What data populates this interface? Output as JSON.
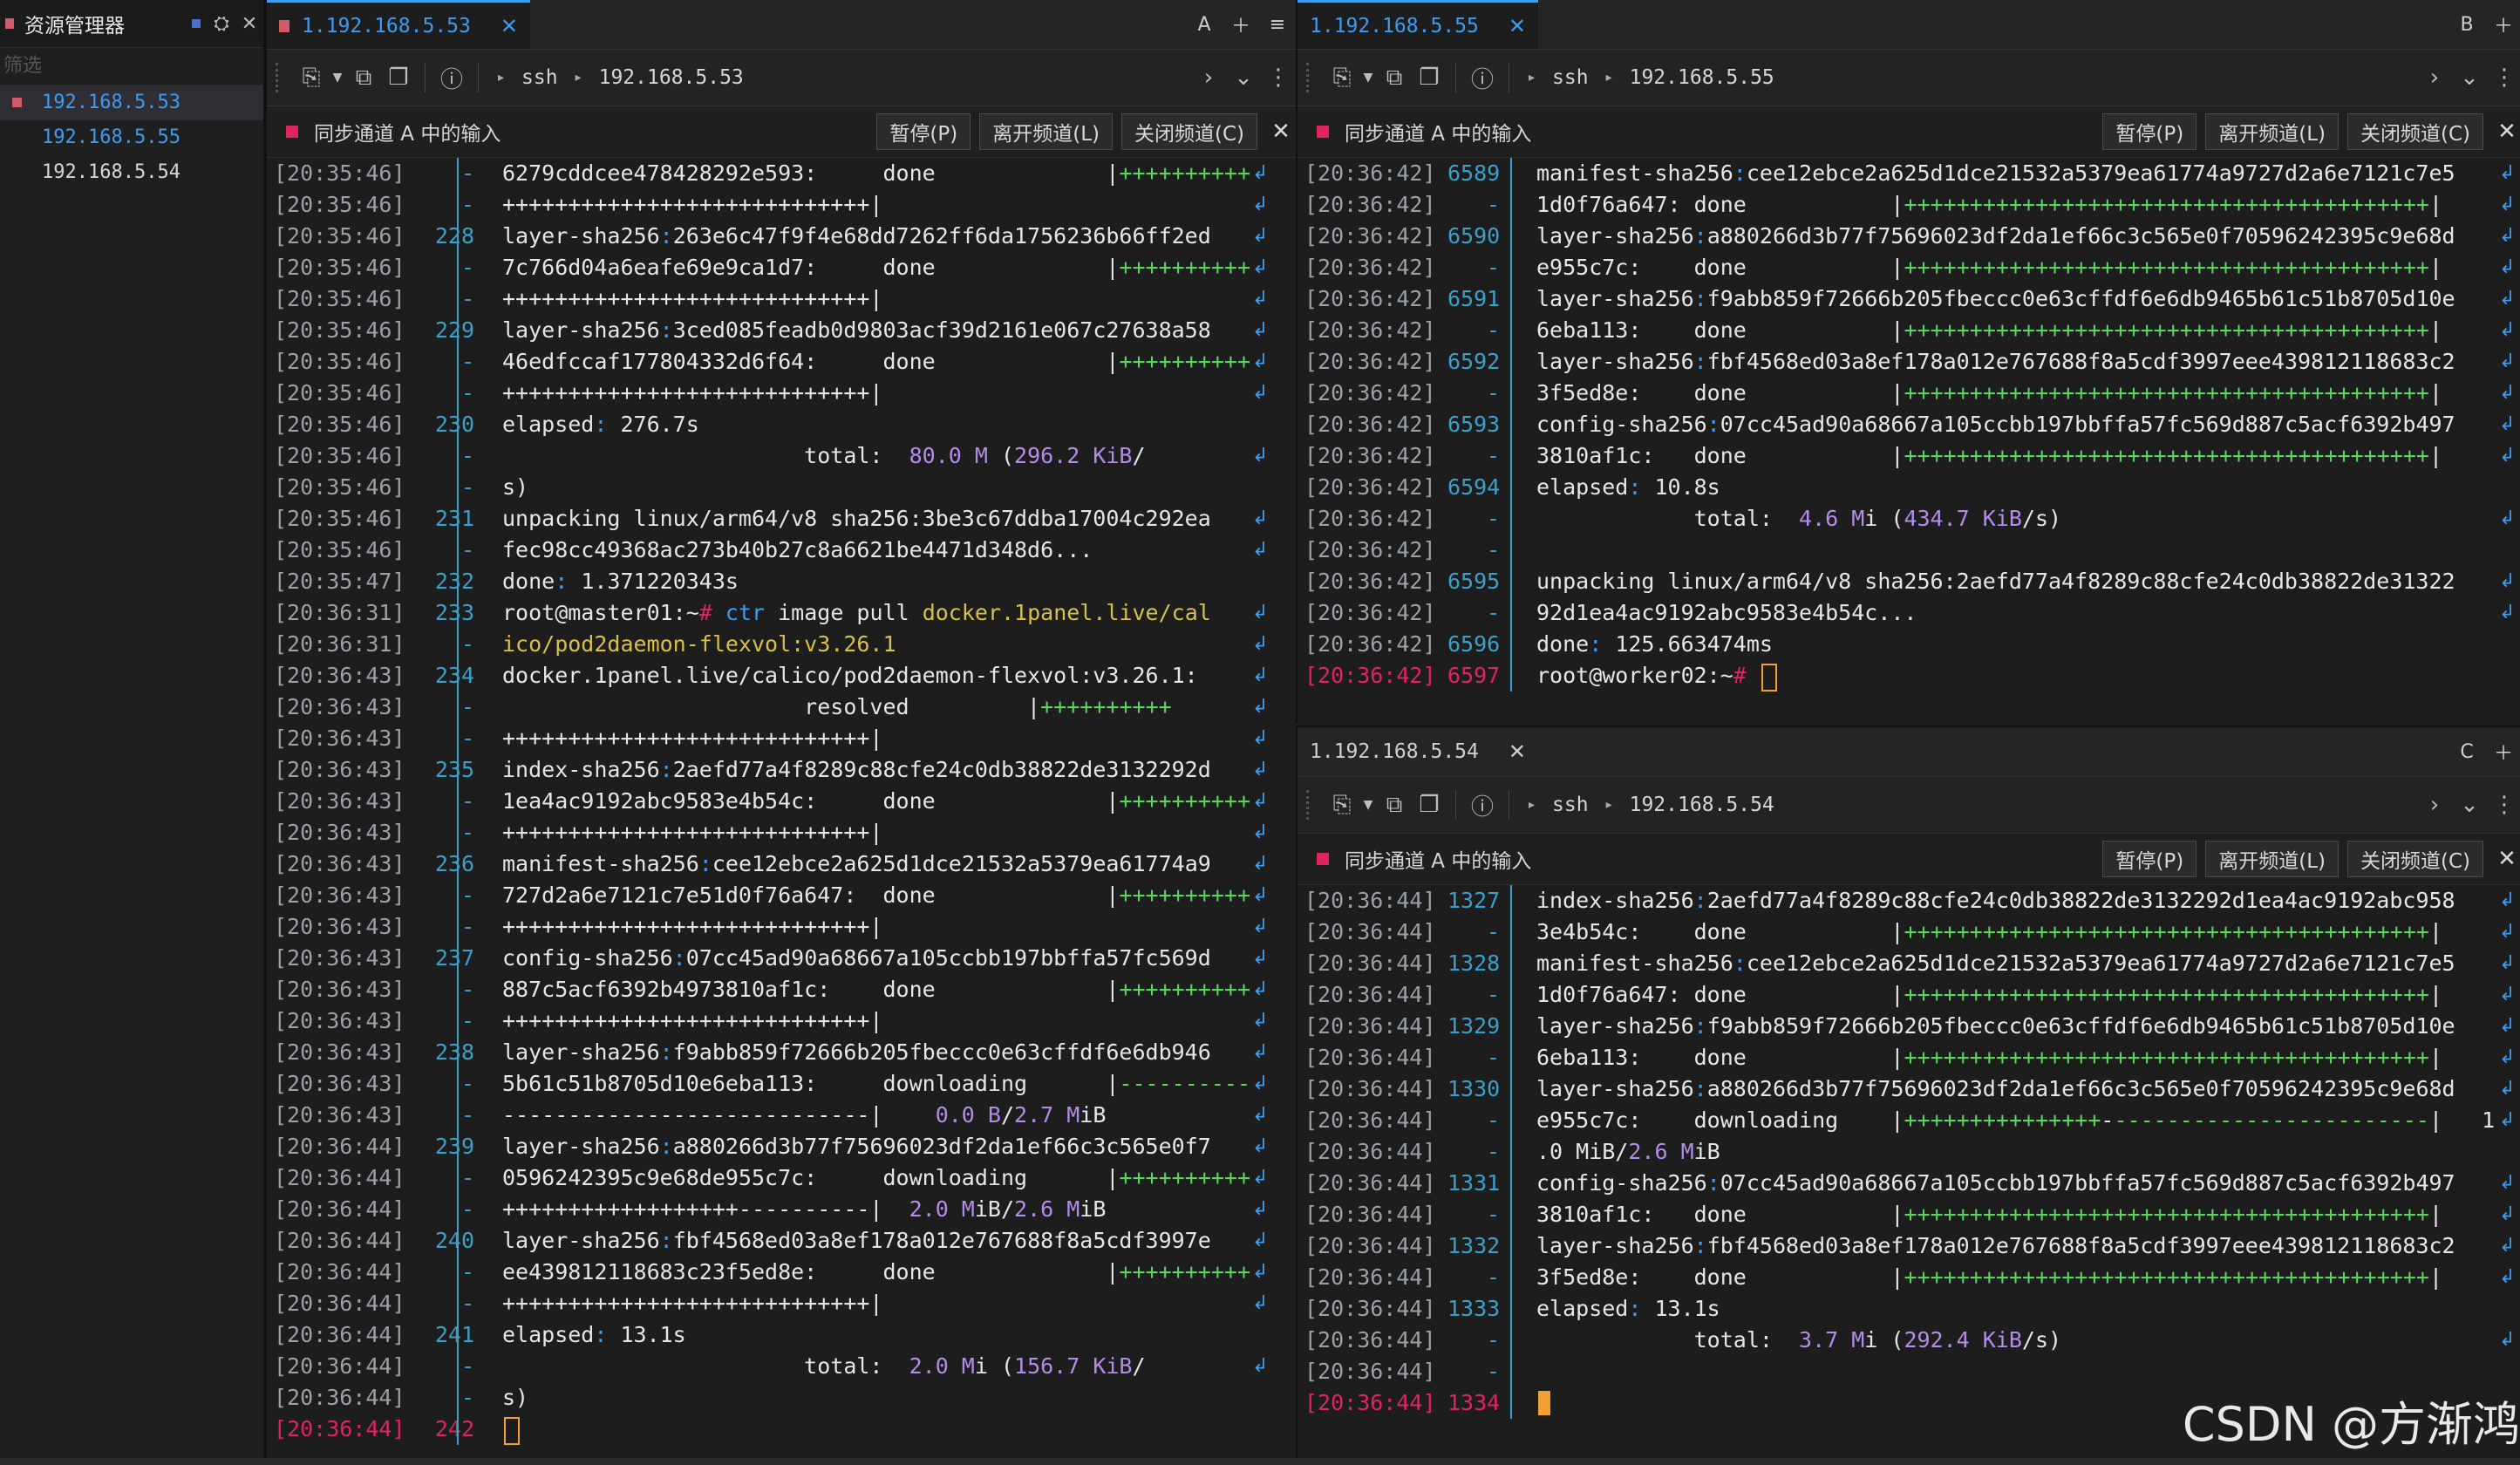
{
  "sidebar": {
    "title": "资源管理器",
    "filter_placeholder": "筛选",
    "items": [
      "192.168.5.53",
      "192.168.5.55",
      "192.168.5.54"
    ]
  },
  "panes": [
    {
      "tab": "1.192.168.5.53",
      "letter": "A",
      "protocol": "ssh",
      "host": "192.168.5.53",
      "sync_label": "同步通道 A 中的输入",
      "btn_pause": "暂停(P)",
      "btn_leave": "离开频道(L)",
      "btn_close": "关闭频道(C)",
      "lines": [
        [
          "[20:35:46]",
          "-",
          "6279cddcee478428292e593:     done             |++++++++++"
        ],
        [
          "[20:35:46]",
          "-",
          "++++++++++++++++++++++++++++|"
        ],
        [
          "[20:35:46]",
          "228",
          "layer-sha256:263e6c47f9f4e68dd7262ff6da1756236b66ff2ed"
        ],
        [
          "[20:35:46]",
          "-",
          "7c766d04a6eafe69e9ca1d7:     done             |++++++++++"
        ],
        [
          "[20:35:46]",
          "-",
          "++++++++++++++++++++++++++++|"
        ],
        [
          "[20:35:46]",
          "229",
          "layer-sha256:3ced085feadb0d9803acf39d2161e067c27638a58"
        ],
        [
          "[20:35:46]",
          "-",
          "46edfccaf177804332d6f64:     done             |++++++++++"
        ],
        [
          "[20:35:46]",
          "-",
          "++++++++++++++++++++++++++++|"
        ],
        [
          "[20:35:46]",
          "230",
          "elapsed: 276.7s"
        ],
        [
          "[20:35:46]",
          "-",
          "                       total:  80.0 M (296.2 KiB/"
        ],
        [
          "[20:35:46]",
          "-",
          "s)"
        ],
        [
          "[20:35:46]",
          "231",
          "unpacking linux/arm64/v8 sha256:3be3c67ddba17004c292ea"
        ],
        [
          "[20:35:46]",
          "-",
          "fec98cc49368ac273b40b27c8a6621be4471d348d6..."
        ],
        [
          "[20:35:47]",
          "232",
          "done: 1.371220343s"
        ],
        [
          "[20:36:31]",
          "233",
          "root@master01:~# ctr image pull docker.1panel.live/cal"
        ],
        [
          "[20:36:31]",
          "-",
          "ico/pod2daemon-flexvol:v3.26.1"
        ],
        [
          "[20:36:43]",
          "234",
          "docker.1panel.live/calico/pod2daemon-flexvol:v3.26.1:"
        ],
        [
          "[20:36:43]",
          "-",
          "                       resolved         |++++++++++"
        ],
        [
          "[20:36:43]",
          "-",
          "++++++++++++++++++++++++++++|"
        ],
        [
          "[20:36:43]",
          "235",
          "index-sha256:2aefd77a4f8289c88cfe24c0db38822de3132292d"
        ],
        [
          "[20:36:43]",
          "-",
          "1ea4ac9192abc9583e4b54c:     done             |++++++++++"
        ],
        [
          "[20:36:43]",
          "-",
          "++++++++++++++++++++++++++++|"
        ],
        [
          "[20:36:43]",
          "236",
          "manifest-sha256:cee12ebce2a625d1dce21532a5379ea61774a9"
        ],
        [
          "[20:36:43]",
          "-",
          "727d2a6e7121c7e51d0f76a647:  done             |++++++++++"
        ],
        [
          "[20:36:43]",
          "-",
          "++++++++++++++++++++++++++++|"
        ],
        [
          "[20:36:43]",
          "237",
          "config-sha256:07cc45ad90a68667a105ccbb197bbffa57fc569d"
        ],
        [
          "[20:36:43]",
          "-",
          "887c5acf6392b4973810af1c:    done             |++++++++++"
        ],
        [
          "[20:36:43]",
          "-",
          "++++++++++++++++++++++++++++|"
        ],
        [
          "[20:36:43]",
          "238",
          "layer-sha256:f9abb859f72666b205fbeccc0e63cffdf6e6db946"
        ],
        [
          "[20:36:43]",
          "-",
          "5b61c51b8705d10e6eba113:     downloading      |----------"
        ],
        [
          "[20:36:43]",
          "-",
          "----------------------------|    0.0 B/2.7 MiB"
        ],
        [
          "[20:36:44]",
          "239",
          "layer-sha256:a880266d3b77f75696023df2da1ef66c3c565e0f7"
        ],
        [
          "[20:36:44]",
          "-",
          "0596242395c9e68de955c7c:     downloading      |++++++++++"
        ],
        [
          "[20:36:44]",
          "-",
          "++++++++++++++++++----------|  2.0 MiB/2.6 MiB"
        ],
        [
          "[20:36:44]",
          "240",
          "layer-sha256:fbf4568ed03a8ef178a012e767688f8a5cdf3997e"
        ],
        [
          "[20:36:44]",
          "-",
          "ee439812118683c23f5ed8e:     done             |++++++++++"
        ],
        [
          "[20:36:44]",
          "-",
          "++++++++++++++++++++++++++++|"
        ],
        [
          "[20:36:44]",
          "241",
          "elapsed: 13.1s"
        ],
        [
          "[20:36:44]",
          "-",
          "                       total:  2.0 Mi (156.7 KiB/"
        ],
        [
          "[20:36:44]",
          "-",
          "s)"
        ],
        [
          "[20:36:44]",
          "242",
          ""
        ]
      ]
    },
    {
      "tab": "1.192.168.5.55",
      "letter": "B",
      "protocol": "ssh",
      "host": "192.168.5.55",
      "sync_label": "同步通道 A 中的输入",
      "btn_pause": "暂停(P)",
      "btn_leave": "离开频道(L)",
      "btn_close": "关闭频道(C)",
      "lines": [
        [
          "[20:36:42]",
          "6589",
          "manifest-sha256:cee12ebce2a625d1dce21532a5379ea61774a9727d2a6e7121c7e5"
        ],
        [
          "[20:36:42]",
          "-",
          "1d0f76a647: done           |++++++++++++++++++++++++++++++++++++++++|"
        ],
        [
          "[20:36:42]",
          "6590",
          "layer-sha256:a880266d3b77f75696023df2da1ef66c3c565e0f70596242395c9e68d"
        ],
        [
          "[20:36:42]",
          "-",
          "e955c7c:    done           |++++++++++++++++++++++++++++++++++++++++|"
        ],
        [
          "[20:36:42]",
          "6591",
          "layer-sha256:f9abb859f72666b205fbeccc0e63cffdf6e6db9465b61c51b8705d10e"
        ],
        [
          "[20:36:42]",
          "-",
          "6eba113:    done           |++++++++++++++++++++++++++++++++++++++++|"
        ],
        [
          "[20:36:42]",
          "6592",
          "layer-sha256:fbf4568ed03a8ef178a012e767688f8a5cdf3997eee439812118683c2"
        ],
        [
          "[20:36:42]",
          "-",
          "3f5ed8e:    done           |++++++++++++++++++++++++++++++++++++++++|"
        ],
        [
          "[20:36:42]",
          "6593",
          "config-sha256:07cc45ad90a68667a105ccbb197bbffa57fc569d887c5acf6392b497"
        ],
        [
          "[20:36:42]",
          "-",
          "3810af1c:   done           |++++++++++++++++++++++++++++++++++++++++|"
        ],
        [
          "[20:36:42]",
          "6594",
          "elapsed: 10.8s"
        ],
        [
          "[20:36:42]",
          "-",
          "            total:  4.6 Mi (434.7 KiB/s)"
        ],
        [
          "[20:36:42]",
          "-",
          ""
        ],
        [
          "[20:36:42]",
          "6595",
          "unpacking linux/arm64/v8 sha256:2aefd77a4f8289c88cfe24c0db38822de31322"
        ],
        [
          "[20:36:42]",
          "-",
          "92d1ea4ac9192abc9583e4b54c..."
        ],
        [
          "[20:36:42]",
          "6596",
          "done: 125.663474ms"
        ],
        [
          "[20:36:42]",
          "6597",
          "root@worker02:~# "
        ]
      ]
    },
    {
      "tab": "1.192.168.5.54",
      "letter": "C",
      "protocol": "ssh",
      "host": "192.168.5.54",
      "sync_label": "同步通道 A 中的输入",
      "btn_pause": "暂停(P)",
      "btn_leave": "离开频道(L)",
      "btn_close": "关闭频道(C)",
      "lines": [
        [
          "[20:36:44]",
          "1327",
          "index-sha256:2aefd77a4f8289c88cfe24c0db38822de3132292d1ea4ac9192abc958"
        ],
        [
          "[20:36:44]",
          "-",
          "3e4b54c:    done           |++++++++++++++++++++++++++++++++++++++++|"
        ],
        [
          "[20:36:44]",
          "1328",
          "manifest-sha256:cee12ebce2a625d1dce21532a5379ea61774a9727d2a6e7121c7e5"
        ],
        [
          "[20:36:44]",
          "-",
          "1d0f76a647: done           |++++++++++++++++++++++++++++++++++++++++|"
        ],
        [
          "[20:36:44]",
          "1329",
          "layer-sha256:f9abb859f72666b205fbeccc0e63cffdf6e6db9465b61c51b8705d10e"
        ],
        [
          "[20:36:44]",
          "-",
          "6eba113:    done           |++++++++++++++++++++++++++++++++++++++++|"
        ],
        [
          "[20:36:44]",
          "1330",
          "layer-sha256:a880266d3b77f75696023df2da1ef66c3c565e0f70596242395c9e68d"
        ],
        [
          "[20:36:44]",
          "-",
          "e955c7c:    downloading    |+++++++++++++++-------------------------|   1"
        ],
        [
          "[20:36:44]",
          "-",
          ".0 MiB/2.6 MiB"
        ],
        [
          "[20:36:44]",
          "1331",
          "config-sha256:07cc45ad90a68667a105ccbb197bbffa57fc569d887c5acf6392b497"
        ],
        [
          "[20:36:44]",
          "-",
          "3810af1c:   done           |++++++++++++++++++++++++++++++++++++++++|"
        ],
        [
          "[20:36:44]",
          "1332",
          "layer-sha256:fbf4568ed03a8ef178a012e767688f8a5cdf3997eee439812118683c2"
        ],
        [
          "[20:36:44]",
          "-",
          "3f5ed8e:    done           |++++++++++++++++++++++++++++++++++++++++|"
        ],
        [
          "[20:36:44]",
          "1333",
          "elapsed: 13.1s"
        ],
        [
          "[20:36:44]",
          "-",
          "            total:  3.7 Mi (292.4 KiB/s)"
        ],
        [
          "[20:36:44]",
          "-",
          ""
        ],
        [
          "[20:36:44]",
          "1334",
          ""
        ]
      ]
    }
  ],
  "watermark": "CSDN @方渐鸿"
}
